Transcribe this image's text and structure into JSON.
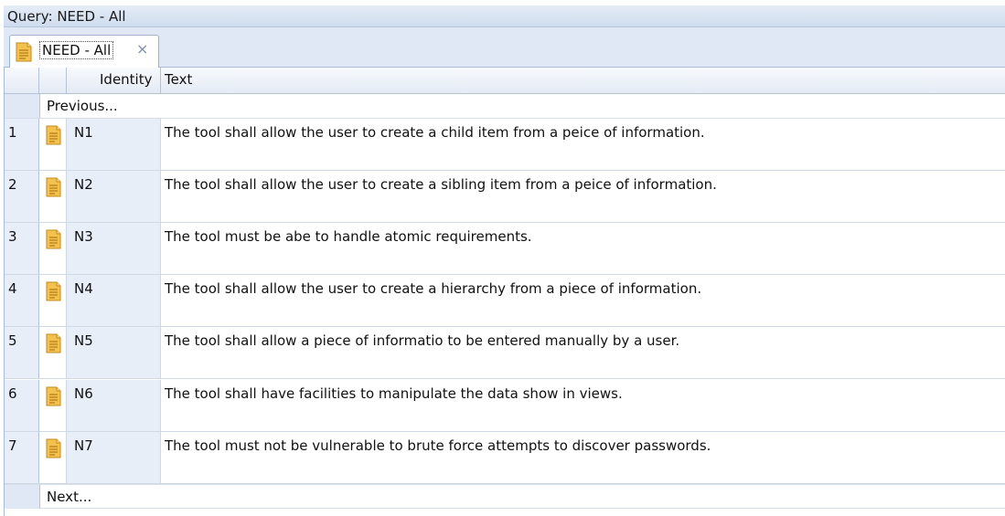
{
  "window": {
    "title": "Query: NEED - All"
  },
  "tab": {
    "label": "NEED - All",
    "close_symbol": "×",
    "icon": "document-icon"
  },
  "table": {
    "columns": [
      "",
      "",
      "Identity",
      "Text"
    ],
    "previous_label": "Previous...",
    "next_label": "Next...",
    "rows": [
      {
        "num": "1",
        "identity": "N1",
        "text": "The tool shall allow the user to create a child item from a peice of information."
      },
      {
        "num": "2",
        "identity": "N2",
        "text": "The tool shall allow the user to create a sibling item from a peice of information."
      },
      {
        "num": "3",
        "identity": "N3",
        "text": "The tool must be abe to handle atomic requirements."
      },
      {
        "num": "4",
        "identity": "N4",
        "text": "The tool shall allow the user to create a hierarchy from a piece of information."
      },
      {
        "num": "5",
        "identity": "N5",
        "text": "The tool shall allow a piece of informatio to be entered manually by a user."
      },
      {
        "num": "6",
        "identity": "N6",
        "text": "The tool shall have facilities to manipulate the data show in views."
      },
      {
        "num": "7",
        "identity": "N7",
        "text": "The tool must not be vulnerable to brute force attempts to discover passwords."
      }
    ]
  },
  "colors": {
    "accent": "#dfe8f4",
    "doc_icon": "#e9b43c"
  }
}
